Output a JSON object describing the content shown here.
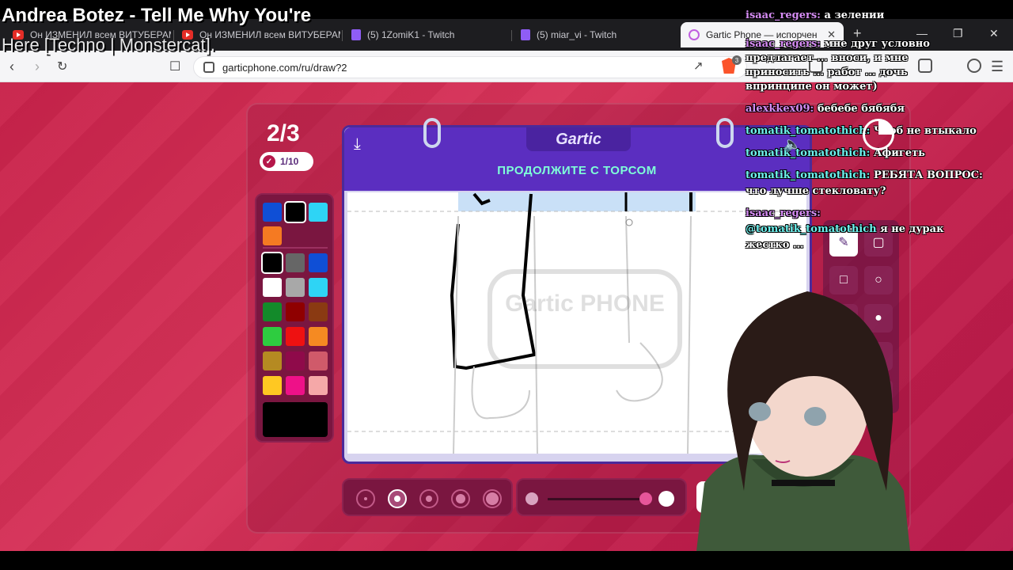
{
  "overlay": {
    "song_title": "Andrea Botez - Tell Me Why You're",
    "song_sub": "Here [Techno | Monstercat]."
  },
  "tabs": [
    {
      "label": "Он ИЗМЕНИЛ всем ВИТУБЕРАМ",
      "icon": "youtube-icon"
    },
    {
      "label": "Он ИЗМЕНИЛ всем ВИТУБЕРАМ",
      "icon": "youtube-icon"
    },
    {
      "label": "(5) 1ZomiK1 - Twitch",
      "icon": "twitch-icon"
    },
    {
      "label": "(5) miar_vi - Twitch",
      "icon": "twitch-icon"
    },
    {
      "label": "Gartic Phone — испорченный",
      "icon": "gartic-icon"
    }
  ],
  "browser": {
    "url": "garticphone.com/ru/draw?2",
    "brave_badge": "3",
    "new_tab": "+",
    "close_tab": "✕"
  },
  "game": {
    "round": "2/3",
    "done_count": "1/10",
    "logo": "Gartic",
    "prompt": "ПРОДОЛЖИТЕ С ТОРСОМ",
    "watermark": "Gartic PHONE",
    "palette_colors": [
      "#0f4fd6",
      "#000000",
      "#2ed4f5",
      "#f57a22",
      "#000000",
      "#666666",
      "#0f4fd6",
      "#ffffff",
      "#a8a8a8",
      "#2ed4f5",
      "#138a2a",
      "#8f0000",
      "#8a3a12",
      "#2ecc40",
      "#ee1111",
      "#f58a22",
      "#b58a22",
      "#8f0a4a",
      "#d05a6a",
      "#ffc822",
      "#ee1188",
      "#f5a8a8"
    ],
    "current_color": "#000000"
  },
  "chat": {
    "messages": [
      {
        "user": "isaac_regers:",
        "text": "а зелении"
      },
      {
        "user": "isaac_regers:",
        "text": "мне друг условно"
      },
      {
        "user": "",
        "text": "предлагает ... вноси, и мне"
      },
      {
        "user": "",
        "text": "приносить ... работ ... дочь"
      },
      {
        "user": "",
        "text": "впринципе он может)"
      },
      {
        "user": "alexkkex09:",
        "text": "бебебе бябябя"
      },
      {
        "user": "tomatik_tomatothich:",
        "text": "Чтоб не втыкало"
      },
      {
        "user": "tomatik_tomatothich:",
        "text": "Афигеть"
      },
      {
        "user": "tomatik_tomatothich:",
        "text": "РЕБЯТА ВОПРОС:"
      },
      {
        "user": "",
        "text": "что лучше стекловату?"
      },
      {
        "user": "isaac_regers:",
        "text": ""
      },
      {
        "user": "@tomatik_tomatothich",
        "text": "я не дурак"
      },
      {
        "user": "",
        "text": "жестко ..."
      }
    ]
  }
}
